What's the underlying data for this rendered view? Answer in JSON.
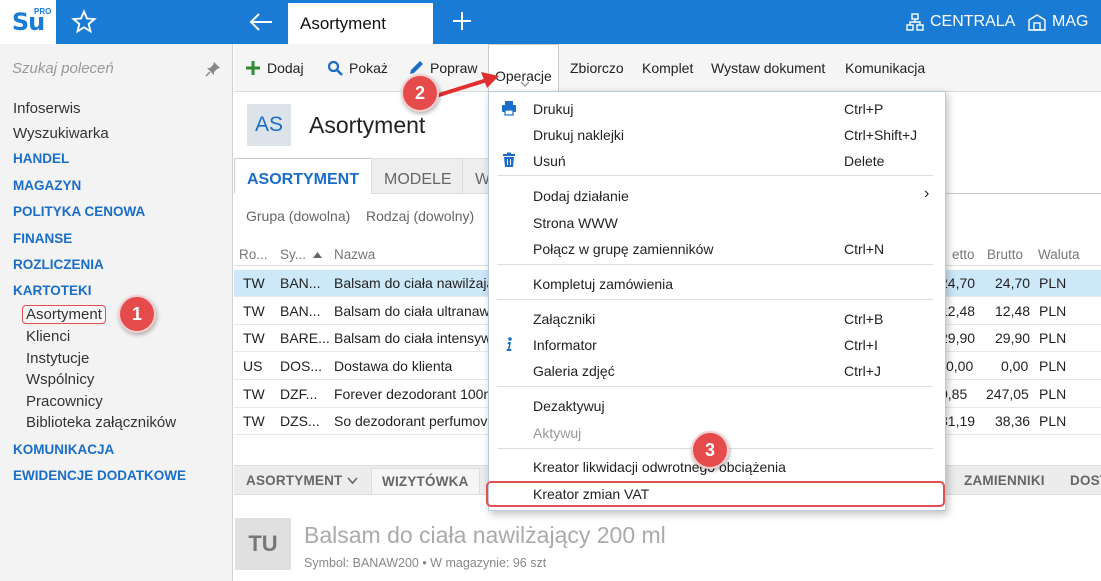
{
  "topbar": {
    "logo_text": "Su",
    "logo_pro": "PRO",
    "active_tab": "Asortyment",
    "centrala": "CENTRALA",
    "mag": "MAG",
    "color": "#1a7bd5"
  },
  "sidebar": {
    "search_placeholder": "Szukaj poleceń",
    "items": [
      {
        "label": "Infoserwis"
      },
      {
        "label": "Wyszukiwarka"
      },
      {
        "label": "HANDEL"
      },
      {
        "label": "MAGAZYN"
      },
      {
        "label": "POLITYKA CENOWA"
      },
      {
        "label": "FINANSE"
      },
      {
        "label": "ROZLICZENIA"
      },
      {
        "label": "KARTOTEKI"
      },
      {
        "label": "Asortyment"
      },
      {
        "label": "Klienci"
      },
      {
        "label": "Instytucje"
      },
      {
        "label": "Wspólnicy"
      },
      {
        "label": "Pracownicy"
      },
      {
        "label": "Biblioteka załączników"
      },
      {
        "label": "KOMUNIKACJA"
      },
      {
        "label": "EWIDENCJE DODATKOWE"
      }
    ]
  },
  "toolbar": {
    "dodaj": "Dodaj",
    "pokaz": "Pokaż",
    "popraw": "Popraw",
    "operacje": "Operacje",
    "zbiorczo": "Zbiorczo",
    "komplet": "Komplet",
    "wystaw": "Wystaw dokument",
    "komunikacja": "Komunikacja"
  },
  "header": {
    "badge": "AS",
    "title": "Asortyment"
  },
  "subtabs": {
    "asortyment": "ASORTYMENT",
    "modele": "MODELE",
    "w": "W"
  },
  "filters": {
    "grupa": "Grupa (dowolna)",
    "rodzaj": "Rodzaj (dowolny)"
  },
  "grid": {
    "headers": {
      "ro": "Ro...",
      "sy": "Sy...",
      "nazwa": "Nazwa",
      "netto": "etto",
      "brutto": "Brutto",
      "waluta": "Waluta"
    },
    "rows": [
      {
        "ro": "TW",
        "sy": "BAN...",
        "nazwa": "Balsam do ciała nawilżają",
        "netto": "24,70",
        "brutto": "24,70",
        "waluta": "PLN"
      },
      {
        "ro": "TW",
        "sy": "BAN...",
        "nazwa": "Balsam do ciała ultranaw",
        "netto": "12,48",
        "brutto": "12,48",
        "waluta": "PLN"
      },
      {
        "ro": "TW",
        "sy": "BARE...",
        "nazwa": "Balsam do ciała intensyw",
        "netto": "29,90",
        "brutto": "29,90",
        "waluta": "PLN"
      },
      {
        "ro": "US",
        "sy": "DOS...",
        "nazwa": "Dostawa do klienta",
        "netto": "0,00",
        "brutto": "0,00",
        "waluta": "PLN"
      },
      {
        "ro": "TW",
        "sy": "DZF...",
        "nazwa": "Forever dezodorant 100n",
        "netto": "0,85",
        "brutto": "247,05",
        "waluta": "PLN"
      },
      {
        "ro": "TW",
        "sy": "DZS...",
        "nazwa": "So dezodorant perfumov",
        "netto": "31,19",
        "brutto": "38,36",
        "waluta": "PLN"
      }
    ]
  },
  "lowtabs": {
    "asortyment": "ASORTYMENT",
    "wizytowka": "WIZYTÓWKA",
    "zamienniki": "ZAMIENNIKI",
    "dost": "DOST"
  },
  "detail": {
    "badge": "TU",
    "title": "Balsam do ciała nawilżający 200 ml",
    "subtitle": "Symbol: BANAW200  •  W magazynie: 96 szt"
  },
  "menu": {
    "items": [
      {
        "label": "Drukuj",
        "shortcut": "Ctrl+P",
        "icon": "printer-icon"
      },
      {
        "label": "Drukuj naklejki",
        "shortcut": "Ctrl+Shift+J"
      },
      {
        "label": "Usuń",
        "shortcut": "Delete",
        "icon": "trash-icon"
      },
      {
        "label": "Dodaj działanie",
        "shortcut": "›"
      },
      {
        "label": "Strona WWW",
        "shortcut": ""
      },
      {
        "label": "Połącz w grupę zamienników",
        "shortcut": "Ctrl+N"
      },
      {
        "label": "Kompletuj zamówienia",
        "shortcut": ""
      },
      {
        "label": "Załączniki",
        "shortcut": "Ctrl+B"
      },
      {
        "label": "Informator",
        "shortcut": "Ctrl+I",
        "icon": "info-icon"
      },
      {
        "label": "Galeria zdjęć",
        "shortcut": "Ctrl+J"
      },
      {
        "label": "Dezaktywuj",
        "shortcut": ""
      },
      {
        "label": "Aktywuj",
        "shortcut": ""
      },
      {
        "label": "Kreator likwidacji odwrotnego obciążenia",
        "shortcut": ""
      },
      {
        "label": "Kreator zmian VAT",
        "shortcut": ""
      }
    ]
  },
  "annotations": {
    "one": "1",
    "two": "2",
    "three": "3",
    "color": "#e54b4b"
  }
}
